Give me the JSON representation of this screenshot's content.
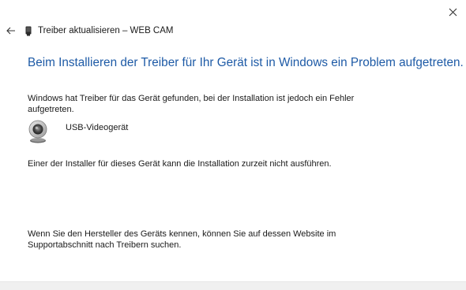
{
  "window": {
    "title": "Treiber aktualisieren – WEB CAM"
  },
  "icons": {
    "close": "close-icon",
    "back": "back-arrow-icon",
    "device": "device-icon",
    "webcam": "webcam-icon"
  },
  "content": {
    "headline": "Beim Installieren der Treiber für Ihr Gerät ist in Windows ein Problem aufgetreten.",
    "message": "Windows hat Treiber für das Gerät gefunden, bei der Installation ist jedoch ein Fehler aufgetreten.",
    "device_name": "USB-Videogerät",
    "installer_note": "Einer der Installer für dieses Gerät kann die Installation zurzeit nicht ausführen.",
    "manufacturer_note": "Wenn Sie den Hersteller des Geräts kennen, können Sie auf dessen Website im Supportabschnitt nach Treibern suchen."
  },
  "colors": {
    "headline": "#1d5aa6",
    "footer": "#f0f0f0"
  }
}
